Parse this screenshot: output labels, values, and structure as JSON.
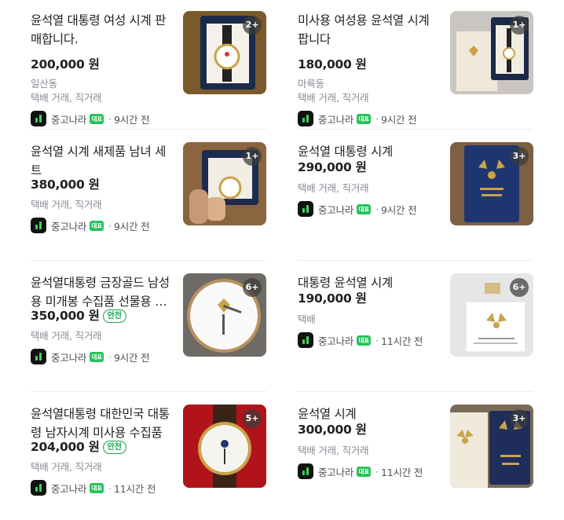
{
  "listings": [
    {
      "title": "윤석열 대통령 여성 시계 판매합니다.",
      "price": "200,000 원",
      "safe": "",
      "location": "일산동",
      "delivery": "택배 거래, 직거래",
      "source": "중고나라",
      "ad": "대표",
      "time": "9시간 전",
      "count": "2+",
      "thumb_colors": {
        "bg": "#7a5a2a",
        "box": "#1a2a4a",
        "inner": "#f4f1ea"
      }
    },
    {
      "title": "미사용 여성용 윤석열 시계 팝니다",
      "price": "180,000 원",
      "safe": "",
      "location": "마륵동",
      "delivery": "택배 거래, 직거래",
      "source": "중고나라",
      "ad": "대표",
      "time": "9시간 전",
      "count": "1+",
      "thumb_colors": {
        "bg": "#c9c6c1",
        "box": "#1c2847",
        "inner": "#efe9dc"
      }
    },
    {
      "title": "윤석열 시계 새제품 남녀 세트",
      "price": "380,000 원",
      "safe": "",
      "location": "",
      "delivery": "택배 거래, 직거래",
      "source": "중고나라",
      "ad": "대표",
      "time": "9시간 전",
      "count": "1+",
      "thumb_colors": {
        "bg": "#8b6540",
        "box": "#1d2b4e",
        "inner": "#f1ede3"
      }
    },
    {
      "title": "윤석열 대통령 시계",
      "price": "290,000 원",
      "safe": "",
      "location": "",
      "delivery": "택배 거래, 직거래",
      "source": "중고나라",
      "ad": "대표",
      "time": "9시간 전",
      "count": "3+",
      "thumb_colors": {
        "bg": "#7d5f44",
        "box": "#1f3570",
        "inner": "#c9a24a"
      }
    },
    {
      "title": "윤석열대통령 금장골드 남성용 미개봉 수집품 선물용 시계",
      "price": "350,000 원",
      "safe": "안전",
      "location": "",
      "delivery": "택배 거래, 직거래",
      "source": "중고나라",
      "ad": "대표",
      "time": "9시간 전",
      "count": "6+",
      "thumb_colors": {
        "bg": "#6e6a66",
        "box": "#b89060",
        "inner": "#fafafa"
      }
    },
    {
      "title": "대통령 윤석열 시계",
      "price": "190,000 원",
      "safe": "",
      "location": "",
      "delivery": "택배",
      "source": "중고나라",
      "ad": "대표",
      "time": "11시간 전",
      "count": "6+",
      "thumb_colors": {
        "bg": "#dcdcdc",
        "box": "#ffffff",
        "inner": "#c9a24a"
      }
    },
    {
      "title": "윤석열대통령 대한민국 대통령 남자시계 미사용 수집품",
      "price": "204,000 원",
      "safe": "안전",
      "location": "",
      "delivery": "택배 거래, 직거래",
      "source": "중고나라",
      "ad": "대표",
      "time": "11시간 전",
      "count": "5+",
      "thumb_colors": {
        "bg": "#b0141a",
        "box": "#3b2417",
        "inner": "#f6f4ee"
      }
    },
    {
      "title": "윤석열 시계",
      "price": "300,000 원",
      "safe": "",
      "location": "",
      "delivery": "택배 거래, 직거래",
      "source": "중고나라",
      "ad": "대표",
      "time": "11시간 전",
      "count": "3+",
      "thumb_colors": {
        "bg": "#7a6a58",
        "box": "#1e2d5a",
        "inner": "#c9a24a"
      }
    }
  ]
}
